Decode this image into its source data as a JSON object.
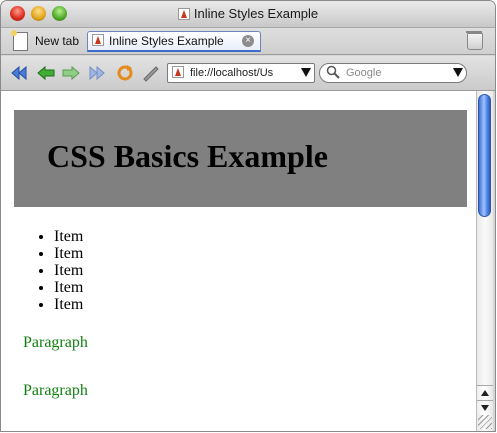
{
  "window": {
    "title": "Inline Styles Example"
  },
  "tabs": {
    "new_tab_label": "New tab",
    "active_tab_label": "Inline Styles Example",
    "close_glyph": "×"
  },
  "toolbar": {
    "url": "file://localhost/Us",
    "search_placeholder": "Google",
    "icons": [
      "back-double-icon",
      "back-icon",
      "forward-icon",
      "forward-double-icon",
      "reload-icon",
      "edit-icon"
    ]
  },
  "page": {
    "heading": "CSS Basics Example",
    "heading_background": "#808080",
    "list_items": [
      "Item",
      "Item",
      "Item",
      "Item",
      "Item"
    ],
    "paragraphs": [
      "Paragraph",
      "Paragraph"
    ],
    "paragraph_color": "#128012"
  },
  "colors": {
    "scrollbar_accent": "#4e84e6",
    "tab_accent": "#3f6cc9"
  }
}
